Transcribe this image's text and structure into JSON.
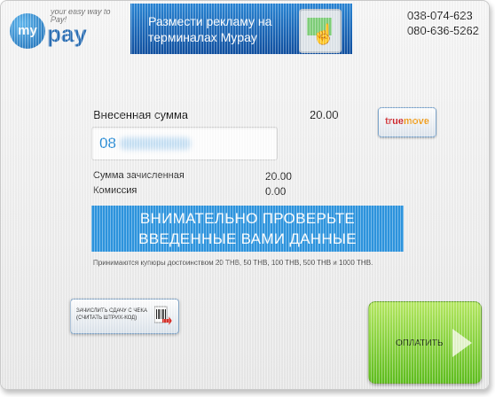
{
  "header": {
    "logo_circle": "my",
    "logo_word": "pay",
    "logo_tagline": "your easy way to Pay!",
    "banner_text": "Размести рекламу на терминалах Mypay",
    "phones": [
      "038-074-623",
      "080-636-5262"
    ]
  },
  "payment": {
    "deposited_label": "Внесенная сумма",
    "deposited_value": "20.00",
    "operator_logo_true": "true",
    "operator_logo_move": "move",
    "phone_prefix": "08",
    "credited_label": "Сумма зачисленная",
    "credited_value": "20.00",
    "commission_label": "Комиссия",
    "commission_value": "0.00",
    "warning_line1": "ВНИМАТЕЛЬНО ПРОВЕРЬТЕ",
    "warning_line2": "ВВЕДЕННЫЕ ВАМИ ДАННЫЕ",
    "accepted_notes": "Принимаются купюры достоинством 20 THB, 50 THB, 100 THB, 500 THB и 1000 THB."
  },
  "buttons": {
    "credit_change_line1": "ЗАЧИСЛИТЬ СДАЧУ С ЧЕКА",
    "credit_change_line2": "(СЧИТАТЬ ШТРИХ-КОД)",
    "pay": "ОПЛАТИТЬ"
  },
  "colors": {
    "accent_blue": "#2e96e0",
    "pay_green": "#5fbf1e",
    "operator_red": "#d0262b",
    "operator_orange": "#f29a12"
  }
}
